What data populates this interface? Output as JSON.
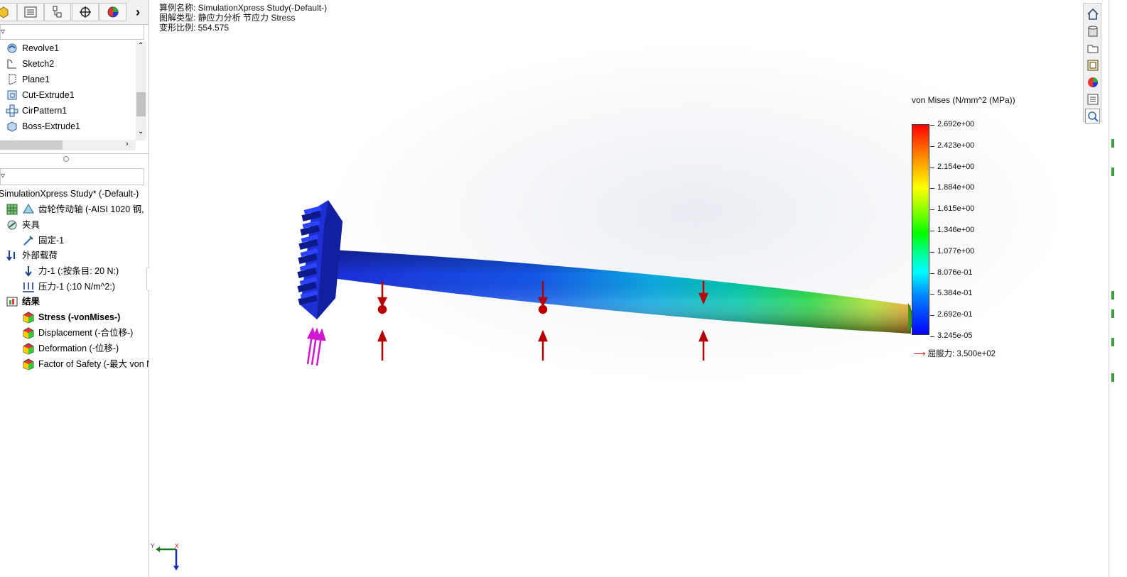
{
  "left_panel": {
    "feature_tree": {
      "items": [
        {
          "label": "Revolve1",
          "icon": "revolve-icon"
        },
        {
          "label": "Sketch2",
          "icon": "sketch-icon"
        },
        {
          "label": "Plane1",
          "icon": "plane-icon"
        },
        {
          "label": "Cut-Extrude1",
          "icon": "cut-extrude-icon"
        },
        {
          "label": "CirPattern1",
          "icon": "circular-pattern-icon"
        },
        {
          "label": "Boss-Extrude1",
          "icon": "boss-extrude-icon"
        }
      ]
    },
    "study_tree": {
      "study": "SimulationXpress Study* (-Default-)",
      "part": "齿轮传动轴 (-AISI 1020 钢, ",
      "fixtures": "夹具",
      "fixture_item": "固定-1",
      "loads": "外部载荷",
      "load_force": "力-1 (:按条目: 20 N:)",
      "load_pressure": "压力-1 (:10 N/m^2:)",
      "results": "结果",
      "result_items": [
        "Stress (-vonMises-)",
        "Displacement (-合位移-)",
        "Deformation (-位移-)",
        "Factor of Safety (-最大 von M"
      ]
    }
  },
  "viewport": {
    "info_lines": [
      "算例名称: SimulationXpress Study(-Default-)",
      "图解类型: 静应力分析 节应力 Stress",
      "变形比例: 554.575"
    ],
    "legend": {
      "title": "von Mises (N/mm^2 (MPa))",
      "labels": [
        "2.692e+00",
        "2.423e+00",
        "2.154e+00",
        "1.884e+00",
        "1.615e+00",
        "1.346e+00",
        "1.077e+00",
        "8.076e-01",
        "5.384e-01",
        "2.692e-01",
        "3.245e-05"
      ],
      "yield": "屈服力: 3.500e+02"
    },
    "triad": {
      "y_label": "Y",
      "x_label": "X"
    }
  },
  "colors": {
    "gear": "#1f2fd6",
    "load_arrow": "#c00000",
    "fixture_arrow": "#d018d0"
  }
}
